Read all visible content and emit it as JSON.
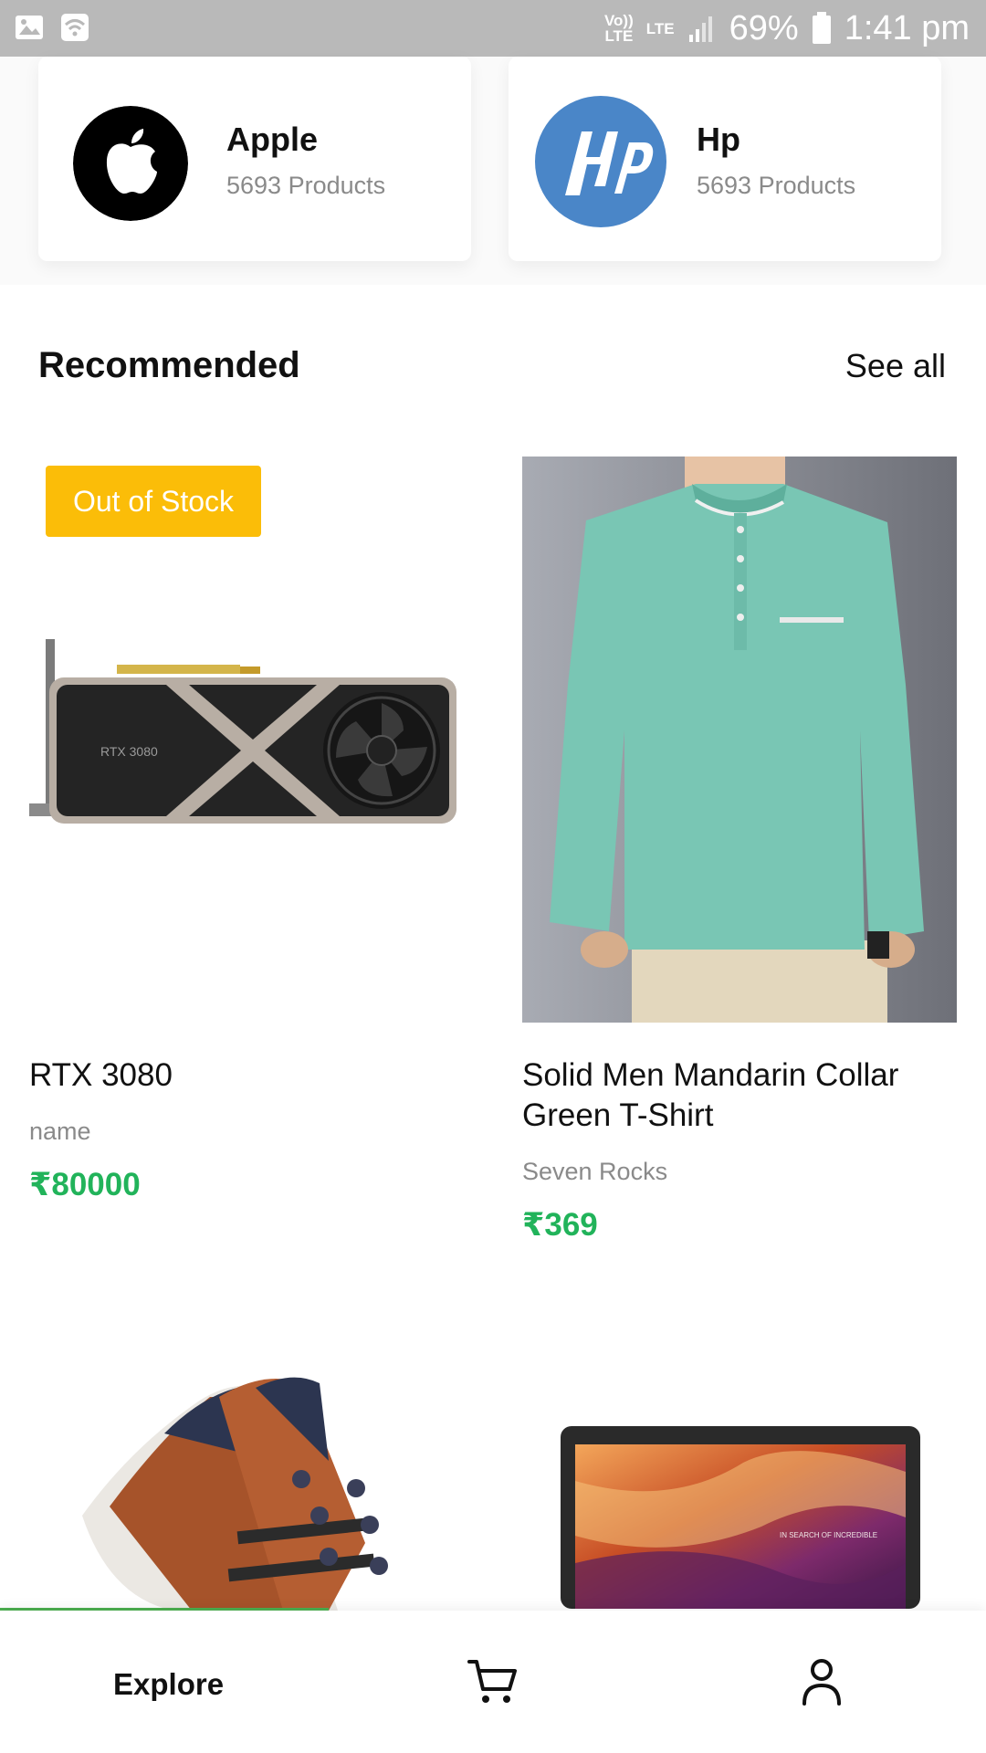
{
  "status_bar": {
    "network_top": "Vo))",
    "network_bottom": "LTE",
    "lte": "LTE",
    "battery": "69%",
    "time": "1:41 pm"
  },
  "brands": [
    {
      "name": "Apple",
      "count": "5693 Products",
      "logo": "apple-logo"
    },
    {
      "name": "Hp",
      "count": "5693 Products",
      "logo": "hp-logo"
    }
  ],
  "recommended": {
    "title": "Recommended",
    "see_all": "See all",
    "products": [
      {
        "title": "RTX 3080",
        "subtitle": "name",
        "price": "₹80000",
        "badge": "Out of Stock",
        "image": "graphics-card",
        "gpu_label": "RTX 3080"
      },
      {
        "title": "Solid Men Mandarin Collar Green T-Shirt",
        "subtitle": "Seven Rocks",
        "price": "₹369",
        "image": "green-tshirt"
      },
      {
        "image": "sneaker"
      },
      {
        "image": "laptop",
        "screen_text": "IN SEARCH OF INCREDIBLE"
      }
    ]
  },
  "bottom_nav": {
    "explore": "Explore",
    "cart_icon": "cart-icon",
    "profile_icon": "profile-icon",
    "progress_fraction": 0.333
  },
  "colors": {
    "price": "#21b35a",
    "badge": "#fbbd08",
    "progress": "#4caf50",
    "hp_blue": "#4a86c8"
  }
}
